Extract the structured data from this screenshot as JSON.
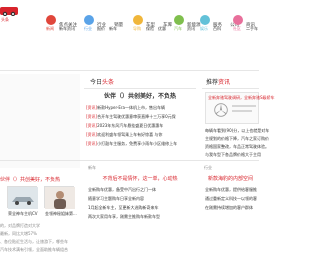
{
  "header": {
    "logo_text": "头条",
    "categories": [
      {
        "name": "新闻",
        "links": [
          "焦点关注",
          "新车资讯"
        ],
        "color": "#e0463b"
      },
      {
        "name": "行业",
        "links": [
          "行业",
          "销量",
          "报价",
          "新车"
        ],
        "color": "#5aa3e8"
      },
      {
        "name": "导购",
        "links": [
          "车型",
          "车库",
          "保险",
          "优惠"
        ],
        "color": "#f0b63a"
      },
      {
        "name": "汽车",
        "links": [
          "新能源",
          "游戏",
          "资讯",
          "科技"
        ],
        "color": "#7fbf4d"
      },
      {
        "name": "娱乐",
        "links": [
          "服务",
          "公司",
          "百科",
          "分享"
        ],
        "color": "#62c1d8"
      },
      {
        "name": "社区",
        "links": [
          "商讯",
          "论坛",
          "一手车",
          "二手车"
        ],
        "color": "#e86f9b"
      }
    ]
  },
  "today": {
    "title_prefix": "今日",
    "title_highlight": "头条",
    "headline": "伙伴（）共创美好，不负热",
    "items": [
      {
        "tag": "[资讯]",
        "text": "新款Hyper-Era一体机上市，售出车辆"
      },
      {
        "tag": "[资讯]",
        "text": "合开车主驾驶优惠意审获直降十三万享0元保"
      },
      {
        "tag": "[资讯]",
        "text": "2023年东风汽车悬挂盛夏日优惠惠车"
      },
      {
        "tag": "[资讯]",
        "text": "欢迎利盛车领驾乘上车有好惊喜 与你"
      },
      {
        "tag": "[资讯]",
        "text": "小打鼓车主服务，免费享小雨车小区维修上车"
      }
    ]
  },
  "recommend": {
    "title_prefix": "推荐",
    "title_highlight": "资讯",
    "card_title": "全新奔驰驾驶调研，全新奔驰S级轿车",
    "lines": [
      "每辆车看到(90)分，以上也就是对车",
      "主规划的价格下降，汽车之家订购价",
      "资格国家整改，车品正常驾驶体验。",
      "与我车型下各品牌价格大于主用"
    ]
  },
  "left_block": {
    "headline": "伙伴（）共创美好，不负热",
    "caption_left": "荣全神车主机CV",
    "caption_right": "金领神秘姐妹第...",
    "text_lines": [
      "的，对品牌打造对大学",
      "最新，同比大增57%",
      "、各位贴近生活与，让旅游下，哪些车",
      "汽车技术满有引领，全面助推车辆组合"
    ]
  },
  "middle_block": {
    "label": "新车",
    "headline": "不背后不是情怀，这一单，心动热",
    "items": [
      "全新购车优惠，备受中汽出行之门一体",
      "随意学习主题购车日享全新内容",
      "1月起全新车主，至更新大选购新奇来车",
      "两次大家用车享，刚需主推购车新款车型"
    ]
  },
  "right_block": {
    "label": "行业",
    "headline": "新款海豹的内部空间",
    "lines": [
      "全新购车优惠，提供给客服推",
      "通过重新定义科技一以领的客",
      "在刚需持续增加的客户群体"
    ]
  }
}
